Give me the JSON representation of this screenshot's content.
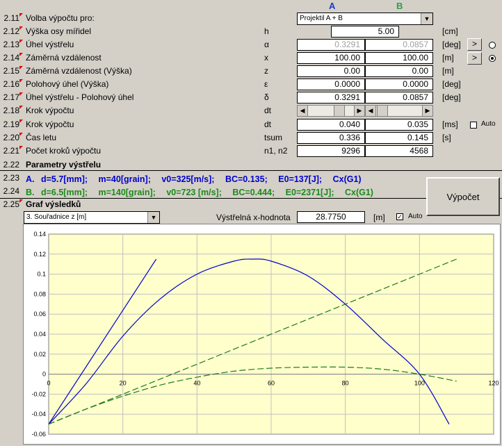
{
  "columns": {
    "a": "A",
    "b": "B"
  },
  "rows": [
    {
      "num": "2.11",
      "label": "Volba výpočtu pro:",
      "sym": "",
      "unit": ""
    },
    {
      "num": "2.12",
      "label": "Výška osy mířidel",
      "sym": "h",
      "unit": "[cm]"
    },
    {
      "num": "2.13",
      "label": "Úhel výstřelu",
      "sym": "α",
      "unit": "[deg]"
    },
    {
      "num": "2.14",
      "label": "Záměrná vzdálenost",
      "sym": "x",
      "unit": "[m]"
    },
    {
      "num": "2.15",
      "label": "Záměrná vzdálenost (Výška)",
      "sym": "z",
      "unit": "[m]"
    },
    {
      "num": "2.16",
      "label": "Polohový úhel (Výška)",
      "sym": "ε",
      "unit": "[deg]"
    },
    {
      "num": "2.17",
      "label": "Úhel výstřelu - Polohový úhel",
      "sym": "δ",
      "unit": "[deg]"
    },
    {
      "num": "2.18",
      "label": "Krok výpočtu",
      "sym": "dt",
      "unit": ""
    },
    {
      "num": "2.19",
      "label": "Krok výpočtu",
      "sym": "dt",
      "unit": "[ms]"
    },
    {
      "num": "2.20",
      "label": "Čas letu",
      "sym": "tsum",
      "unit": "[s]"
    },
    {
      "num": "2.21",
      "label": "Počet kroků výpočtu",
      "sym": "n1, n2",
      "unit": ""
    },
    {
      "num": "2.22",
      "label": "Parametry výstřelu",
      "sym": "",
      "unit": ""
    },
    {
      "num": "2.23",
      "label": "",
      "sym": "",
      "unit": ""
    },
    {
      "num": "2.24",
      "label": "",
      "sym": "",
      "unit": ""
    },
    {
      "num": "2.25",
      "label": "Graf výsledků",
      "sym": "",
      "unit": ""
    }
  ],
  "values": {
    "calc_select": "Projektil A + B",
    "h": "5.00",
    "alpha_a": "0.3291",
    "alpha_b": "0.0857",
    "x_a": "100.00",
    "x_b": "100.00",
    "z_a": "0.00",
    "z_b": "0.00",
    "eps_a": "0.0000",
    "eps_b": "0.0000",
    "delta_a": "0.3291",
    "delta_b": "0.0857",
    "dt_a": "0.040",
    "dt_b": "0.035",
    "tsum_a": "0.336",
    "tsum_b": "0.145",
    "n_a": "9296",
    "n_b": "4568"
  },
  "auto_label": "Auto",
  "arrow_button": ">",
  "param_a": [
    "A.",
    "d=5.7[mm];",
    "m=40[grain];",
    "v0=325[m/s];",
    "BC=0.135;",
    "E0=137[J];",
    "Cx(G1)"
  ],
  "param_b": [
    "B.",
    "d=6.5[mm];",
    "m=140[grain];",
    "v0=723 [m/s];",
    "BC=0.444;",
    "E0=2371[J];",
    "Cx(G1)"
  ],
  "calc_button": "Výpočet",
  "graph_select": "3. Souřadnice z [m]",
  "x_value_label": "Výstřelná x-hodnota",
  "x_value": "28.7750",
  "x_value_unit": "[m]",
  "colors": {
    "a": "#0000cc",
    "b": "#1a7a1a",
    "plot_bg": "#ffffcc",
    "chart_bg": "#ffffff"
  },
  "chart_data": {
    "type": "line",
    "xlim": [
      0,
      120
    ],
    "ylim": [
      -0.06,
      0.14
    ],
    "x_ticks": [
      "0",
      "20",
      "40",
      "60",
      "80",
      "100",
      "120"
    ],
    "y_ticks": [
      "0.14",
      "0.12",
      "0.1",
      "0.08",
      "0.06",
      "0.04",
      "0.02",
      "0",
      "-0.02",
      "-0.04",
      "-0.06"
    ],
    "grid": true,
    "series": [
      {
        "color": "#0000cc",
        "style": "solid",
        "x": [
          0,
          29
        ],
        "y": [
          -0.05,
          0.115
        ]
      },
      {
        "color": "#0000cc",
        "style": "solid",
        "x": [
          0,
          10,
          20,
          30,
          40,
          50,
          55,
          60,
          70,
          80,
          90,
          100,
          108
        ],
        "y": [
          -0.05,
          -0.01,
          0.038,
          0.075,
          0.1,
          0.113,
          0.115,
          0.113,
          0.098,
          0.07,
          0.035,
          0,
          -0.05
        ]
      },
      {
        "color": "#1a7a1a",
        "style": "dashed",
        "x": [
          0,
          110
        ],
        "y": [
          -0.05,
          0.115
        ]
      },
      {
        "color": "#1a7a1a",
        "style": "dashed",
        "x": [
          0,
          10,
          20,
          30,
          40,
          50,
          60,
          70,
          80,
          90,
          100,
          110
        ],
        "y": [
          -0.05,
          -0.035,
          -0.022,
          -0.011,
          -0.003,
          0.003,
          0.006,
          0.007,
          0.007,
          0.005,
          0,
          -0.007
        ]
      }
    ]
  }
}
